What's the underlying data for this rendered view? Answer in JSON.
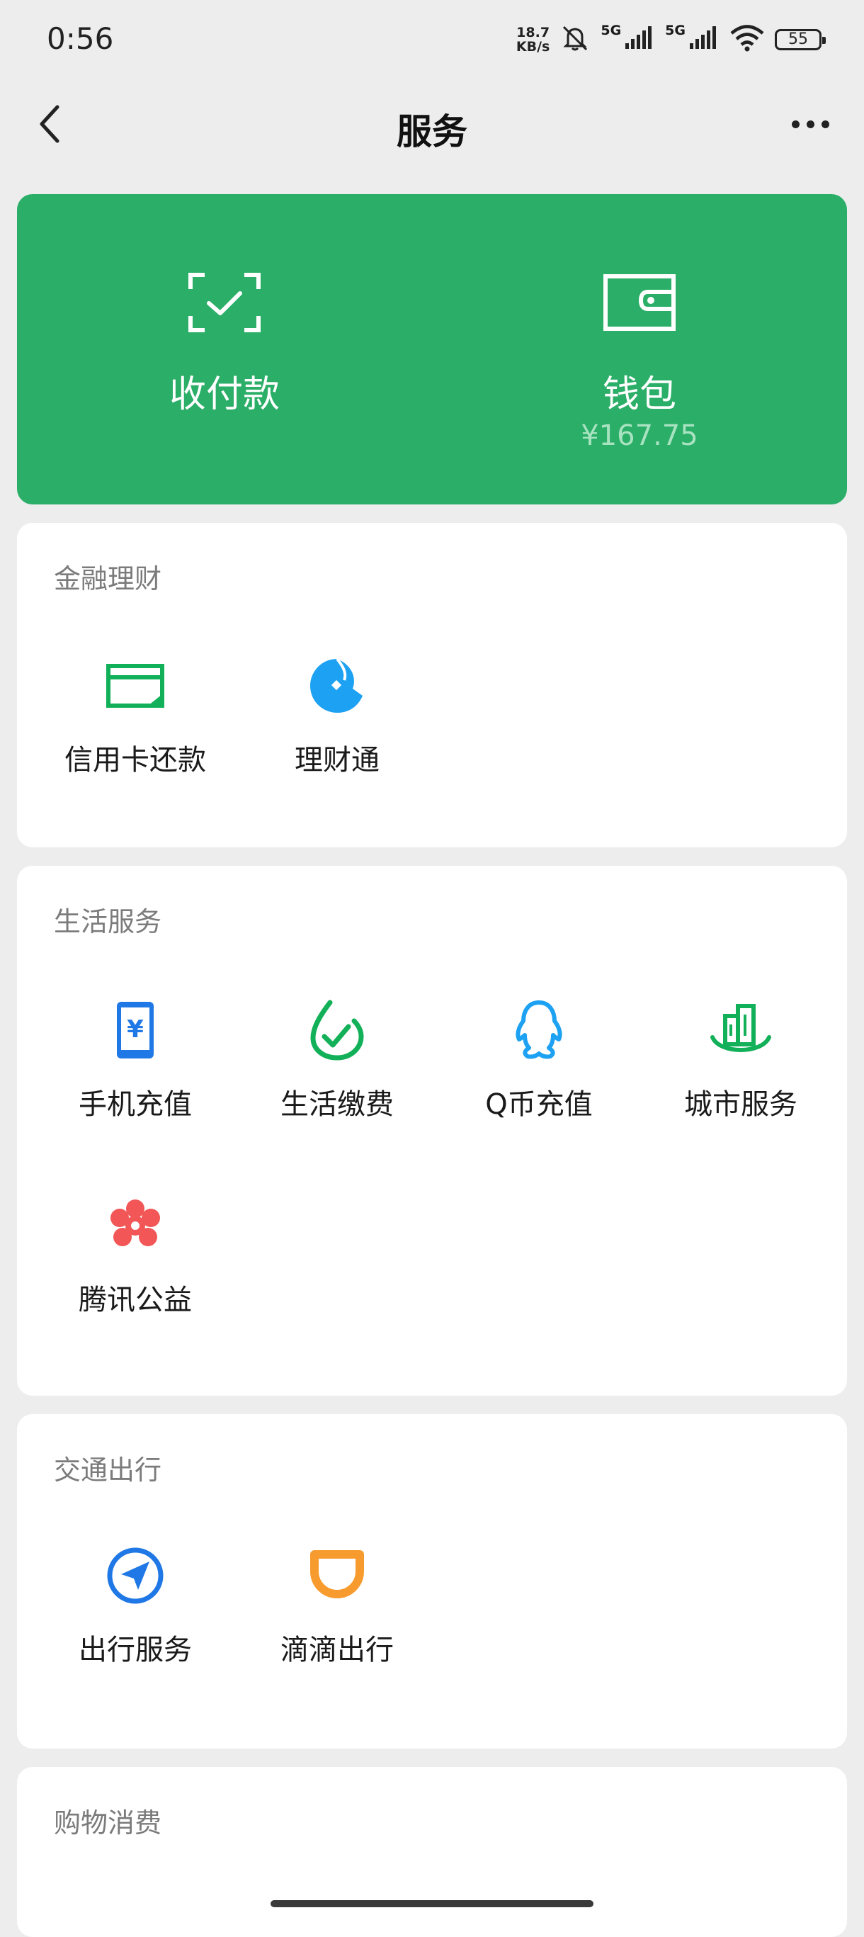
{
  "status_bar": {
    "time": "0:56",
    "net_speed_value": "18.7",
    "net_speed_unit": "KB/s",
    "signal_1": "5G",
    "signal_2": "5G",
    "battery": "55"
  },
  "nav": {
    "title": "服务"
  },
  "top_card": {
    "pay_label": "收付款",
    "wallet_label": "钱包",
    "wallet_balance": "¥167.75",
    "accent_color": "#2bae67"
  },
  "sections": {
    "finance": {
      "title": "金融理财",
      "items": [
        {
          "label": "信用卡还款",
          "icon": "credit-card-icon"
        },
        {
          "label": "理财通",
          "icon": "wealth-icon"
        }
      ]
    },
    "life": {
      "title": "生活服务",
      "items": [
        {
          "label": "手机充值",
          "icon": "phone-topup-icon"
        },
        {
          "label": "生活缴费",
          "icon": "utility-bill-icon"
        },
        {
          "label": "Q币充值",
          "icon": "qq-coin-icon"
        },
        {
          "label": "城市服务",
          "icon": "city-service-icon"
        },
        {
          "label": "腾讯公益",
          "icon": "charity-icon"
        }
      ]
    },
    "transport": {
      "title": "交通出行",
      "items": [
        {
          "label": "出行服务",
          "icon": "travel-service-icon"
        },
        {
          "label": "滴滴出行",
          "icon": "didi-icon"
        }
      ]
    },
    "shopping": {
      "title": "购物消费"
    }
  }
}
